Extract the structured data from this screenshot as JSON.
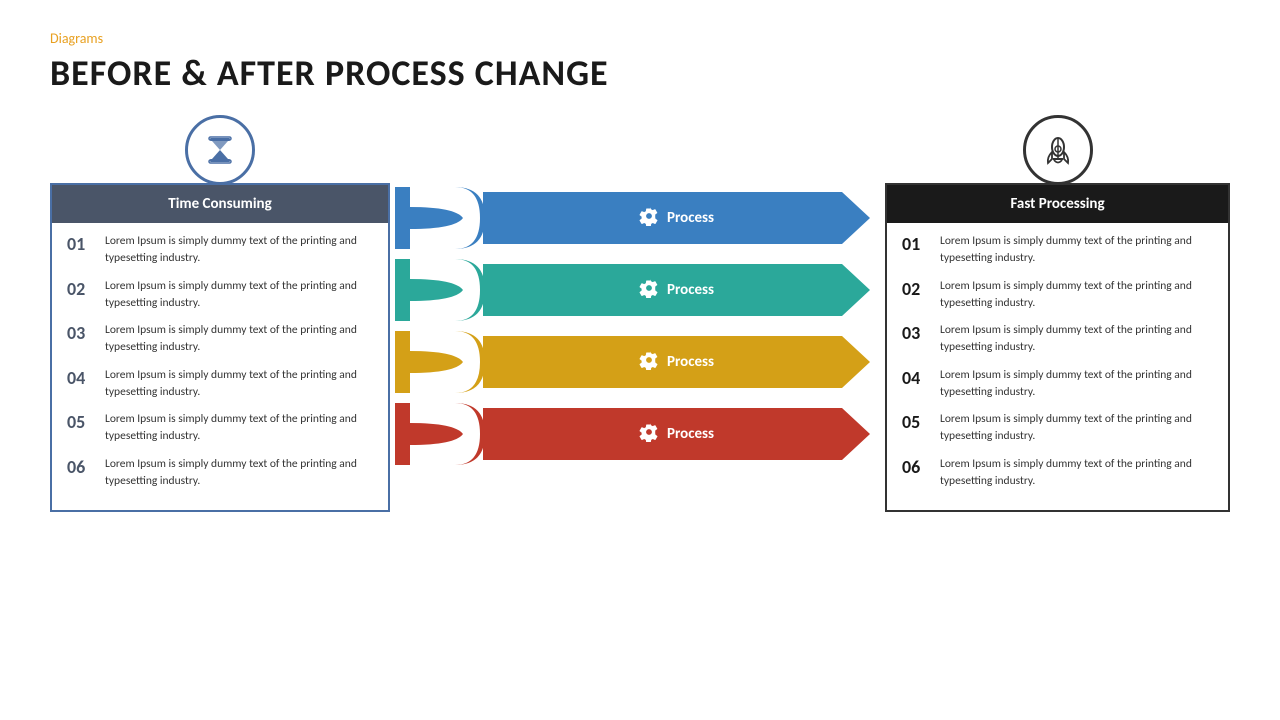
{
  "header": {
    "category": "Diagrams",
    "title": "BEFORE & AFTER PROCESS CHANGE"
  },
  "left_panel": {
    "icon_label": "hourglass",
    "title": "Time Consuming",
    "items": [
      {
        "num": "01",
        "text": "Lorem Ipsum is simply dummy text of the printing and typesetting industry."
      },
      {
        "num": "02",
        "text": "Lorem Ipsum is simply dummy text of the printing and typesetting industry."
      },
      {
        "num": "03",
        "text": "Lorem Ipsum is simply dummy text of the printing and typesetting industry."
      },
      {
        "num": "04",
        "text": "Lorem Ipsum is simply dummy text of the printing and typesetting industry."
      },
      {
        "num": "05",
        "text": "Lorem Ipsum is simply dummy text of the printing and typesetting industry."
      },
      {
        "num": "06",
        "text": "Lorem Ipsum is simply dummy text of the printing and typesetting industry."
      }
    ]
  },
  "middle": {
    "processes": [
      {
        "label": "Process",
        "color": "blue"
      },
      {
        "label": "Process",
        "color": "teal"
      },
      {
        "label": "Process",
        "color": "yellow"
      },
      {
        "label": "Process",
        "color": "red"
      }
    ]
  },
  "right_panel": {
    "icon_label": "rocket",
    "title": "Fast Processing",
    "items": [
      {
        "num": "01",
        "text": "Lorem Ipsum is simply dummy text of the printing and typesetting industry."
      },
      {
        "num": "02",
        "text": "Lorem Ipsum is simply dummy text of the printing and typesetting industry."
      },
      {
        "num": "03",
        "text": "Lorem Ipsum is simply dummy text of the printing and typesetting industry."
      },
      {
        "num": "04",
        "text": "Lorem Ipsum is simply dummy text of the printing and typesetting industry."
      },
      {
        "num": "05",
        "text": "Lorem Ipsum is simply dummy text of the printing and typesetting industry."
      },
      {
        "num": "06",
        "text": "Lorem Ipsum is simply dummy text of the printing and typesetting industry."
      }
    ]
  },
  "colors": {
    "orange_accent": "#e8a020",
    "blue": "#3a7fc1",
    "teal": "#2ba89a",
    "yellow": "#d4a017",
    "red": "#c0392b",
    "dark_header": "#4a5568",
    "black_header": "#1a1a1a"
  },
  "icons": {
    "gear": "⚙",
    "hourglass": "⌛",
    "rocket": "🚀"
  }
}
